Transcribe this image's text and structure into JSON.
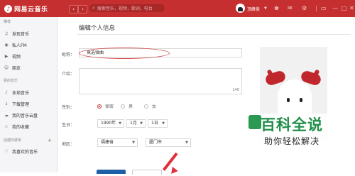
{
  "titlebar": {
    "app_name": "网易云音乐",
    "back": "‹",
    "forward": "›",
    "search_placeholder": "搜索音乐，视频，歌词，电台",
    "username": "顶峰俊"
  },
  "sidebar": {
    "sec_recommend": "推荐",
    "items_recommend": [
      "发现音乐",
      "私人FM",
      "视频",
      "朋友"
    ],
    "sec_mymusic": "我的音乐",
    "items_mymusic": [
      "本地音乐",
      "下载管理",
      "我的音乐云盘",
      "我的收藏"
    ],
    "sec_created": "创建的歌单",
    "items_created": [
      "我喜欢的音乐"
    ]
  },
  "form": {
    "page_title": "编辑个人信息",
    "nickname_label": "昵称：",
    "nickname_value": "竟选弹曲",
    "intro_label": "介绍：",
    "intro_counter": "140",
    "gender_label": "性别：",
    "gender_options": [
      "保密",
      "男",
      "女"
    ],
    "birthday_label": "生日：",
    "birth_year": "1990年",
    "birth_month": "1月",
    "birth_day": "1日",
    "region_label": "地区：",
    "province": "福建省",
    "city": "厦门市"
  },
  "watermark": {
    "title": "百科全说",
    "subtitle": "助你轻松解决"
  },
  "colors": {
    "brand_red": "#c62f2f",
    "save_blue": "#1f5fa8",
    "watermark_green": "#1f8f4a"
  }
}
